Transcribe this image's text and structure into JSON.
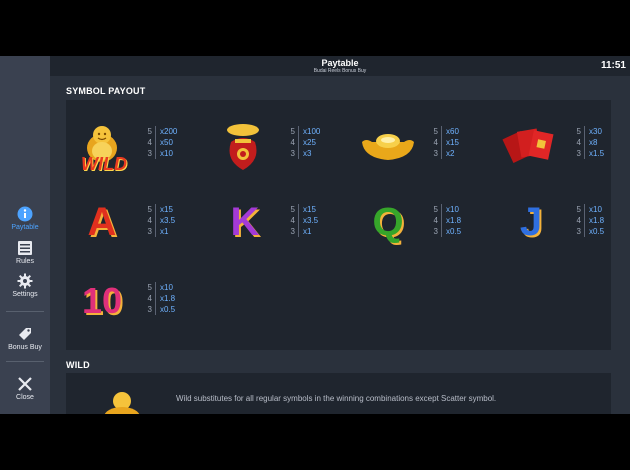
{
  "header": {
    "title": "Paytable",
    "subtitle": "Budai Reels Bonus Buy",
    "clock": "11:51"
  },
  "sidebar": {
    "items": [
      {
        "label": "Paytable",
        "icon": "info-icon",
        "active": true
      },
      {
        "label": "Rules",
        "icon": "rules-icon"
      },
      {
        "label": "Settings",
        "icon": "gear-icon"
      },
      {
        "label": "Bonus Buy",
        "icon": "tag-icon"
      },
      {
        "label": "Close",
        "icon": "close-icon"
      }
    ]
  },
  "symbol_payout": {
    "heading": "SYMBOL PAYOUT",
    "symbols": [
      {
        "id": "budai-wild",
        "label": "WILD",
        "payouts": [
          {
            "count": "5",
            "mult": "x200"
          },
          {
            "count": "4",
            "mult": "x50"
          },
          {
            "count": "3",
            "mult": "x10"
          }
        ]
      },
      {
        "id": "money-bag",
        "payouts": [
          {
            "count": "5",
            "mult": "x100"
          },
          {
            "count": "4",
            "mult": "x25"
          },
          {
            "count": "3",
            "mult": "x3"
          }
        ]
      },
      {
        "id": "gold-ingot",
        "payouts": [
          {
            "count": "5",
            "mult": "x60"
          },
          {
            "count": "4",
            "mult": "x15"
          },
          {
            "count": "3",
            "mult": "x2"
          }
        ]
      },
      {
        "id": "red-envelopes",
        "payouts": [
          {
            "count": "5",
            "mult": "x30"
          },
          {
            "count": "4",
            "mult": "x8"
          },
          {
            "count": "3",
            "mult": "x1.5"
          }
        ]
      },
      {
        "id": "ace",
        "label": "A",
        "payouts": [
          {
            "count": "5",
            "mult": "x15"
          },
          {
            "count": "4",
            "mult": "x3.5"
          },
          {
            "count": "3",
            "mult": "x1"
          }
        ]
      },
      {
        "id": "king",
        "label": "K",
        "payouts": [
          {
            "count": "5",
            "mult": "x15"
          },
          {
            "count": "4",
            "mult": "x3.5"
          },
          {
            "count": "3",
            "mult": "x1"
          }
        ]
      },
      {
        "id": "queen",
        "label": "Q",
        "payouts": [
          {
            "count": "5",
            "mult": "x10"
          },
          {
            "count": "4",
            "mult": "x1.8"
          },
          {
            "count": "3",
            "mult": "x0.5"
          }
        ]
      },
      {
        "id": "jack",
        "label": "J",
        "payouts": [
          {
            "count": "5",
            "mult": "x10"
          },
          {
            "count": "4",
            "mult": "x1.8"
          },
          {
            "count": "3",
            "mult": "x0.5"
          }
        ]
      },
      {
        "id": "ten",
        "label": "10",
        "payouts": [
          {
            "count": "5",
            "mult": "x10"
          },
          {
            "count": "4",
            "mult": "x1.8"
          },
          {
            "count": "3",
            "mult": "x0.5"
          }
        ]
      }
    ]
  },
  "wild": {
    "heading": "WILD",
    "description": "Wild substitutes for all regular symbols in the winning combinations except Scatter symbol."
  },
  "colors": {
    "accent": "#4da3ff",
    "multiplier": "#6fb2ff",
    "panel": "#1f252e"
  }
}
